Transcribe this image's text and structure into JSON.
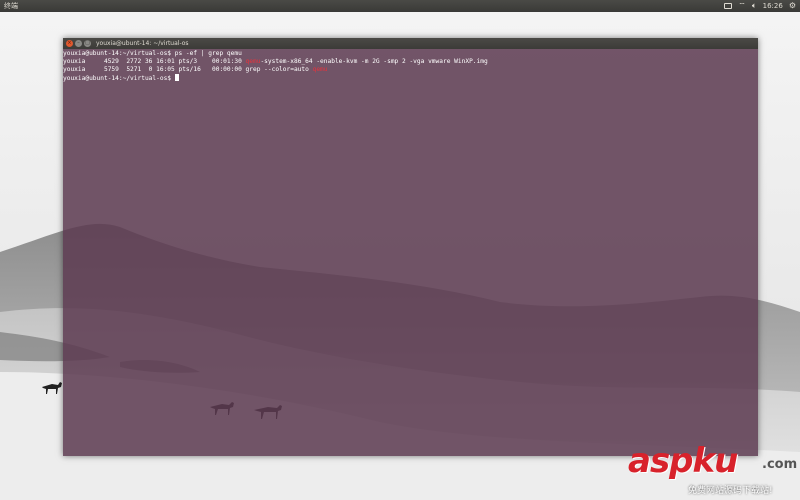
{
  "top_panel": {
    "title": "终端",
    "clock": "16:26",
    "icons": [
      "keyboard-icon",
      "wifi-icon",
      "volume-icon",
      "power-icon"
    ]
  },
  "terminal": {
    "window_title": "youxia@ubunt-14: ~/virtual-os",
    "lines": [
      {
        "pre": "youxia@ubunt-14:~/virtual-os$ ps -ef | grep qemu",
        "hl": "",
        "post": ""
      },
      {
        "pre": "youxia     4529  2772 36 16:01 pts/3    00:01:30 ",
        "hl": "qemu",
        "post": "-system-x86_64 -enable-kvm -m 2G -smp 2 -vga vmware WinXP.img"
      },
      {
        "pre": "youxia     5759  5271  0 16:05 pts/16   00:00:00 grep --color=auto ",
        "hl": "qemu",
        "post": ""
      },
      {
        "pre": "youxia@ubunt-14:~/virtual-os$ ",
        "hl": "",
        "post": ""
      }
    ],
    "colors": {
      "background": "#5c3a50",
      "highlight": "#e8323c"
    }
  },
  "watermark": {
    "main": "aspku",
    "tld": ".com",
    "sub": "免费网站源码下载站!"
  }
}
